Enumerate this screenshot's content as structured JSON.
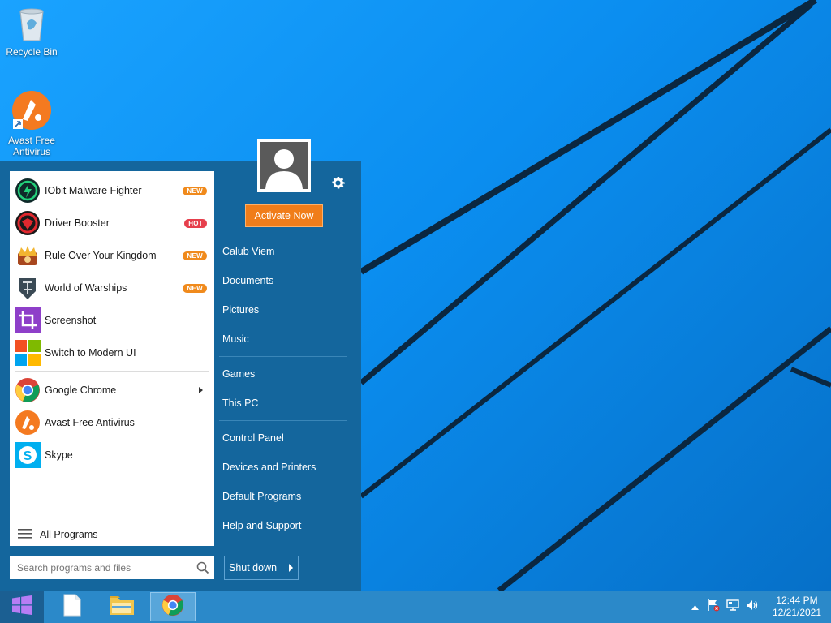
{
  "desktop": {
    "icons": [
      {
        "label": "Recycle Bin",
        "icon": "recycle-bin-icon"
      },
      {
        "label": "Avast Free Antivirus",
        "icon": "avast-icon"
      }
    ]
  },
  "start_menu": {
    "apps": [
      {
        "label": "IObit Malware Fighter",
        "icon": "iobit-malware-fighter-icon",
        "badge": "NEW"
      },
      {
        "label": "Driver Booster",
        "icon": "driver-booster-icon",
        "badge": "HOT"
      },
      {
        "label": "Rule Over Your Kingdom",
        "icon": "kingdom-crown-icon",
        "badge": "NEW"
      },
      {
        "label": "World of Warships",
        "icon": "world-of-warships-icon",
        "badge": "NEW"
      },
      {
        "label": "Screenshot",
        "icon": "crop-icon",
        "badge": ""
      },
      {
        "label": "Switch to Modern UI",
        "icon": "windows-tiles-icon",
        "badge": ""
      },
      {
        "label": "Google Chrome",
        "icon": "chrome-icon",
        "badge": ""
      },
      {
        "label": "Avast Free Antivirus",
        "icon": "avast-icon",
        "badge": ""
      },
      {
        "label": "Skype",
        "icon": "skype-icon",
        "badge": ""
      }
    ],
    "all_programs": "All Programs",
    "search_placeholder": "Search programs and files",
    "activate_label": "Activate Now",
    "places": [
      "Calub Viem",
      "Documents",
      "Pictures",
      "Music",
      "Games",
      "This PC",
      "Control Panel",
      "Devices and Printers",
      "Default Programs",
      "Help and Support"
    ],
    "shutdown_label": "Shut down"
  },
  "taskbar": {
    "clock_time": "12:44 PM",
    "clock_date": "12/21/2021"
  },
  "colors": {
    "menu_bg": "#14669d",
    "accent_orange": "#f07d1a",
    "taskbar": "#2b89c9"
  }
}
